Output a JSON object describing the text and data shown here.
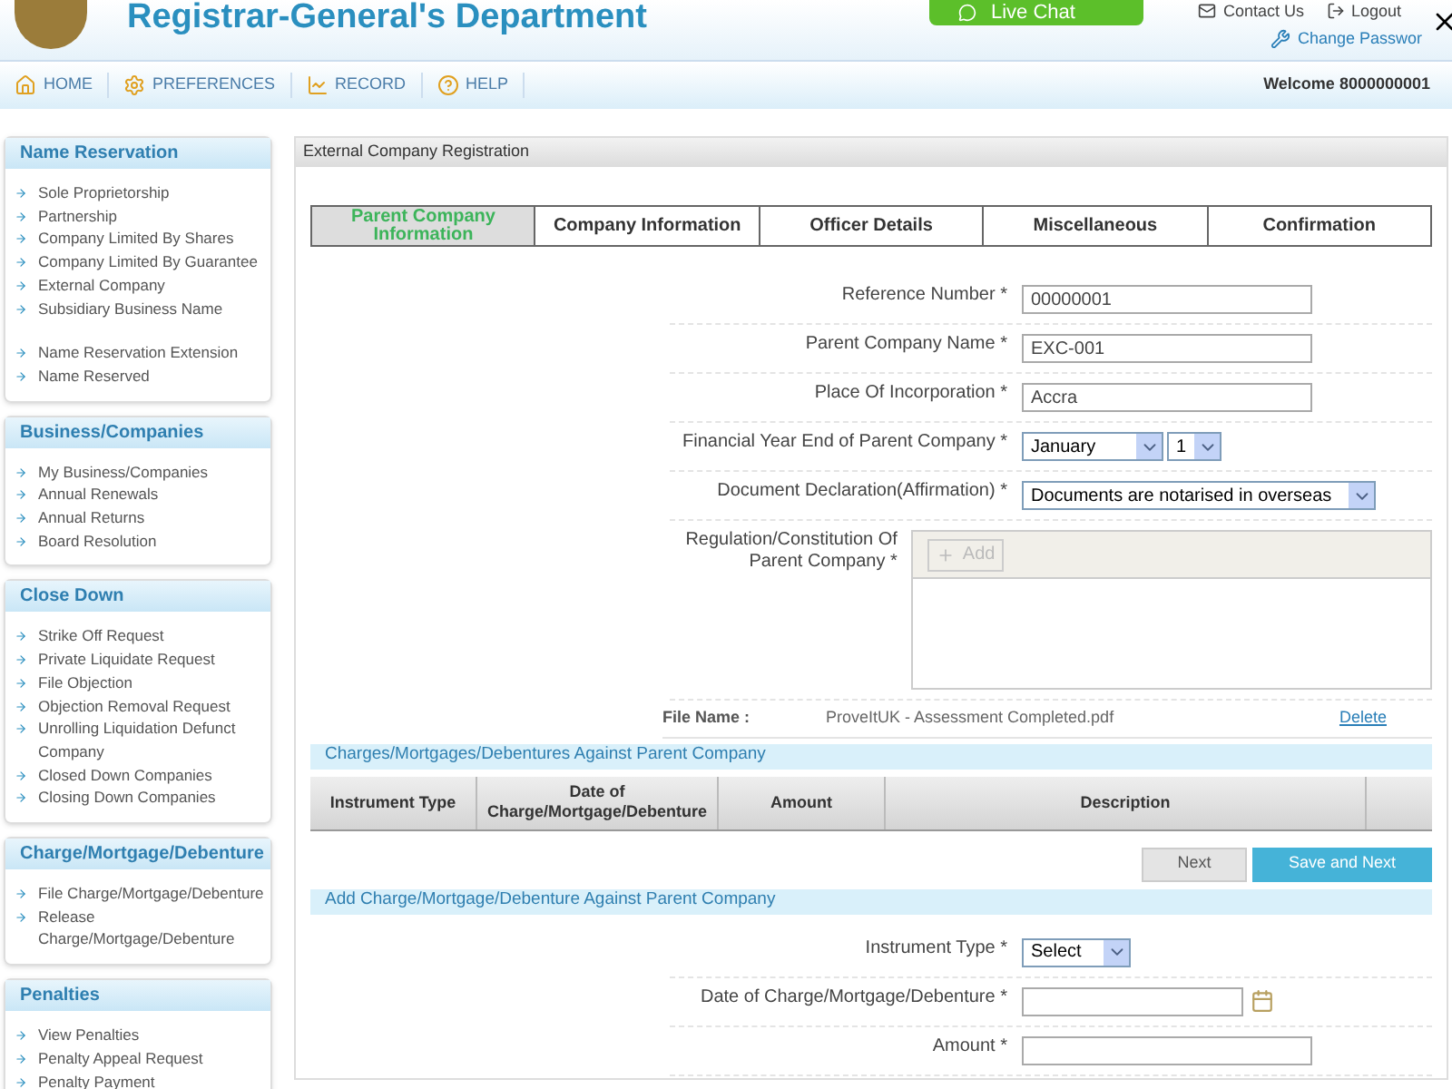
{
  "header": {
    "title": "Registrar-General's Department",
    "live_chat": "Live Chat",
    "links": [
      "Contact Us",
      "Logout"
    ],
    "change_password": "Change Passwor"
  },
  "nav": {
    "items": [
      "HOME",
      "PREFERENCES",
      "RECORD",
      "HELP"
    ],
    "welcome": "Welcome 8000000001"
  },
  "sidebar": [
    {
      "title": "Name Reservation",
      "groups": [
        [
          "Sole Proprietorship",
          "Partnership",
          "Company Limited By Shares",
          "Company Limited By Guarantee",
          "External Company",
          "Subsidiary Business Name"
        ],
        [
          "Name Reservation Extension",
          "Name Reserved"
        ]
      ]
    },
    {
      "title": "Business/Companies",
      "groups": [
        [
          "My Business/Companies",
          "Annual Renewals",
          "Annual Returns",
          "Board Resolution"
        ]
      ]
    },
    {
      "title": "Close Down",
      "groups": [
        [
          "Strike Off Request",
          "Private Liquidate Request",
          "File Objection",
          "Objection Removal Request",
          "Unrolling Liquidation Defunct Company",
          "Closed Down Companies",
          "Closing Down Companies"
        ]
      ]
    },
    {
      "title": "Charge/Mortgage/Debenture",
      "groups": [
        [
          "File Charge/Mortgage/Debenture",
          "Release Charge/Mortgage/Debenture"
        ]
      ]
    },
    {
      "title": "Penalties",
      "groups": [
        [
          "View Penalties",
          "Penalty Appeal Request",
          "Penalty Payment"
        ]
      ]
    }
  ],
  "main": {
    "title": "External Company Registration",
    "tabs": [
      {
        "label": "Parent Company Information",
        "selected": true
      },
      {
        "label": "Company Information",
        "selected": false
      },
      {
        "label": "Officer Details",
        "selected": false
      },
      {
        "label": "Miscellaneous",
        "selected": false
      },
      {
        "label": "Confirmation",
        "selected": false
      }
    ],
    "fields": [
      {
        "kind": "text",
        "label": "Reference Number *",
        "value": "00000001"
      },
      {
        "kind": "text",
        "label": "Parent Company Name *",
        "value": "EXC-001"
      },
      {
        "kind": "text",
        "label": "Place Of Incorporation *",
        "value": "Accra"
      },
      {
        "kind": "selects",
        "label": "Financial Year End of Parent Company *",
        "values": [
          "January",
          "1"
        ]
      },
      {
        "kind": "select",
        "label": "Document Declaration(Affirmation) *",
        "value": "Documents are notarised in overseas"
      },
      {
        "kind": "upload",
        "label": "Regulation/Constitution Of Parent Company *",
        "button": "Add"
      }
    ],
    "file": {
      "label": "File Name :",
      "name": "ProveItUK - Assessment Completed.pdf",
      "action": "Delete"
    },
    "charges": {
      "title": "Charges/Mortgages/Debentures Against Parent Company",
      "columns": [
        "Instrument Type",
        "Date of Charge/Mortgage/Debenture",
        "Amount",
        "Description"
      ]
    },
    "buttons": [
      {
        "label": "Next",
        "kind": "secondary"
      },
      {
        "label": "Save and Next",
        "kind": "primary"
      }
    ],
    "add": {
      "title": "Add Charge/Mortgage/Debenture Against Parent Company",
      "fields": [
        {
          "kind": "select",
          "label": "Instrument Type *",
          "value": "Select"
        },
        {
          "kind": "date",
          "label": "Date of Charge/Mortgage/Debenture *"
        },
        {
          "kind": "text",
          "label": "Amount *"
        }
      ]
    }
  }
}
